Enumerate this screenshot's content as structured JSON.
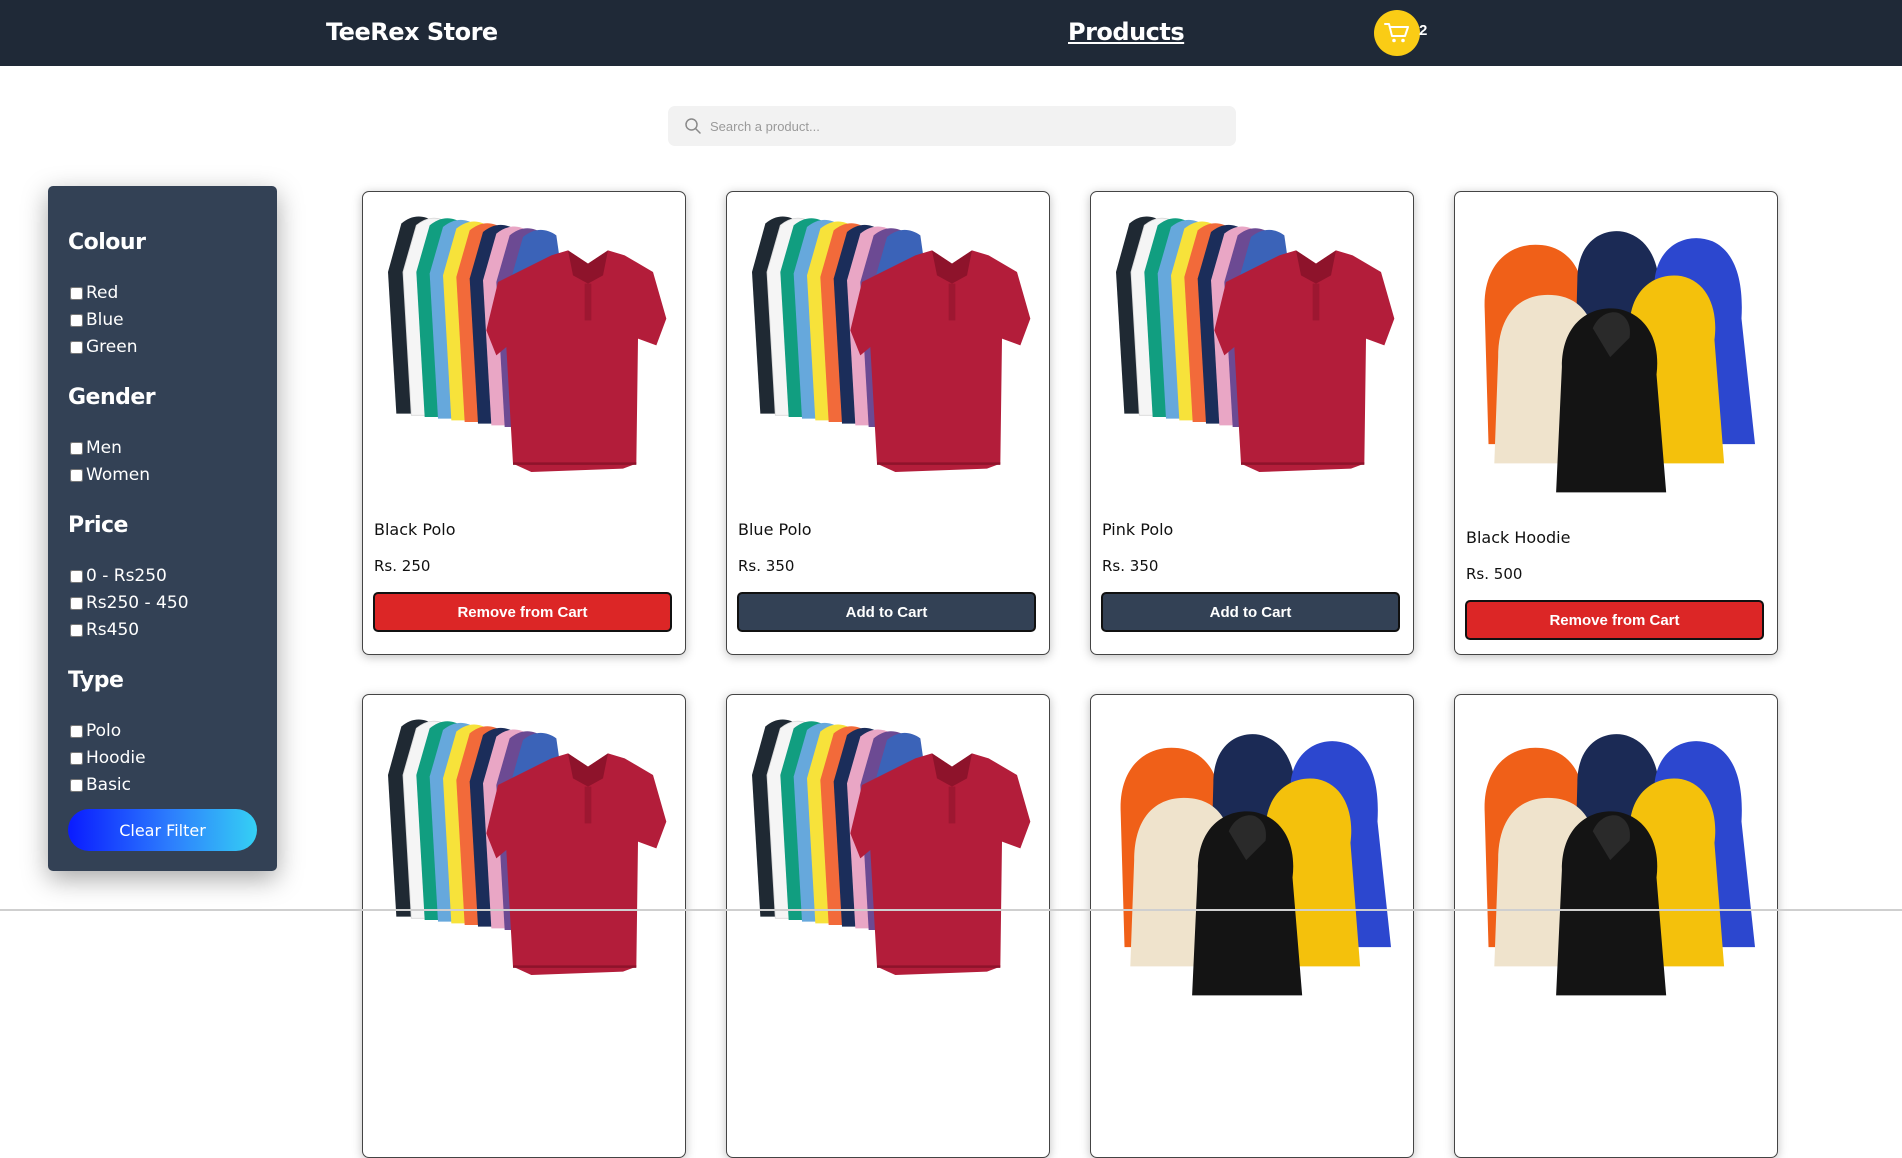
{
  "navbar": {
    "brand": "TeeRex Store",
    "products_link": "Products",
    "cart_count": "2",
    "cart_icon": "shopping-cart-icon",
    "colors": {
      "bg": "#1f2937",
      "cart": "#facc15"
    }
  },
  "search": {
    "placeholder": "Search a product...",
    "value": "",
    "icon": "search-icon"
  },
  "filters": {
    "colour": {
      "title": "Colour",
      "options": [
        "Red",
        "Blue",
        "Green"
      ]
    },
    "gender": {
      "title": "Gender",
      "options": [
        "Men",
        "Women"
      ]
    },
    "price": {
      "title": "Price",
      "options": [
        "0 - Rs250",
        "Rs250 - 450",
        "Rs450"
      ]
    },
    "type": {
      "title": "Type",
      "options": [
        "Polo",
        "Hoodie",
        "Basic"
      ]
    },
    "clear_label": "Clear Filter"
  },
  "products": [
    {
      "name": "Black Polo",
      "price": "Rs. 250",
      "action": "Remove from Cart",
      "image": "polo-shirts-image"
    },
    {
      "name": "Blue Polo",
      "price": "Rs. 350",
      "action": "Add to Cart",
      "image": "polo-shirts-image"
    },
    {
      "name": "Pink Polo",
      "price": "Rs. 350",
      "action": "Add to Cart",
      "image": "polo-shirts-image"
    },
    {
      "name": "Black Hoodie",
      "price": "Rs. 500",
      "action": "Remove from Cart",
      "image": "hoodies-image"
    },
    {
      "image": "polo-shirts-image"
    },
    {
      "image": "polo-shirts-image"
    },
    {
      "image": "hoodies-image"
    },
    {
      "image": "hoodies-image"
    }
  ],
  "colors": {
    "remove": "#dc2626",
    "add": "#334155",
    "sidebar": "#334155"
  }
}
